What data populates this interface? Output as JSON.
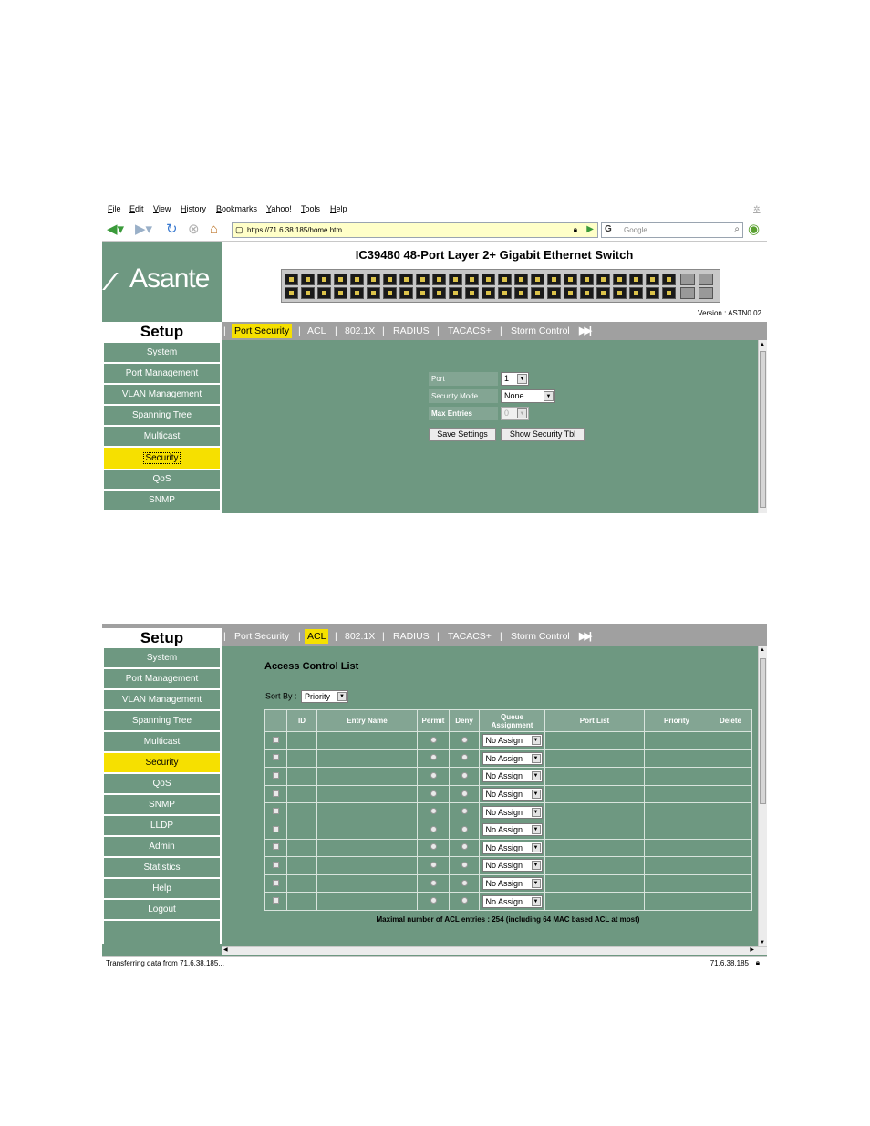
{
  "browser": {
    "menu": [
      "File",
      "Edit",
      "View",
      "History",
      "Bookmarks",
      "Yahoo!",
      "Tools",
      "Help"
    ],
    "url": "https://71.6.38.185/home.htm",
    "search_placeholder": "Google",
    "status_text": "Transferring data from 71.6.38.185...",
    "status_host": "71.6.38.185"
  },
  "header": {
    "logo_text": "Asante",
    "device_title": "IC39480 48-Port Layer 2+ Gigabit Ethernet Switch",
    "version": "Version :  ASTN0.02"
  },
  "sidebar": {
    "title": "Setup",
    "items": [
      "System",
      "Port Management",
      "VLAN Management",
      "Spanning Tree",
      "Multicast",
      "Security",
      "QoS",
      "SNMP",
      "LLDP",
      "Admin",
      "Statistics",
      "Help",
      "Logout"
    ],
    "active": "Security"
  },
  "tabs": {
    "items": [
      "Port Security",
      "ACL",
      "802.1X",
      "RADIUS",
      "TACACS+",
      "Storm Control"
    ],
    "sep": "|",
    "more_icon": "fast-forward-icon"
  },
  "port_security": {
    "port_label": "Port",
    "port_value": "1",
    "mode_label": "Security Mode",
    "mode_value": "None",
    "max_label": "Max Entries",
    "max_value": "0",
    "save_button": "Save Settings",
    "show_button": "Show Security Tbl"
  },
  "acl": {
    "title": "Access Control List",
    "sort_label": "Sort By :",
    "sort_value": "Priority",
    "columns": [
      "",
      "ID",
      "Entry Name",
      "Permit",
      "Deny",
      "Queue Assignment",
      "Port List",
      "Priority",
      "Delete"
    ],
    "queue_value": "No Assign",
    "row_count": 10,
    "note": "Maximal number of ACL entries : 254 (including 64 MAC based ACL at most)"
  },
  "colors": {
    "content_bg": "#6e9881",
    "active_yellow": "#f6e000",
    "tab_bar": "#a0a0a0"
  }
}
